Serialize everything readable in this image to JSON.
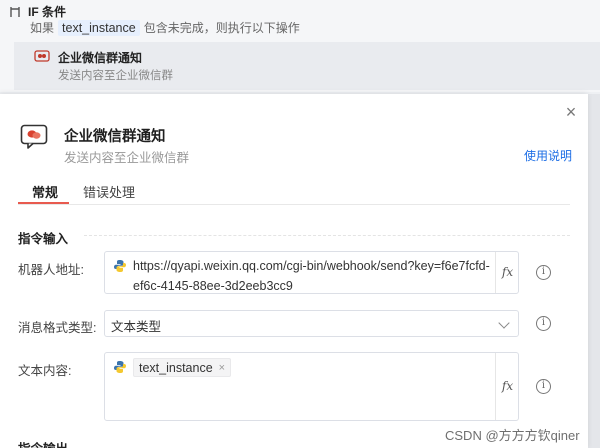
{
  "workflow": {
    "if_title": "IF 条件",
    "if_desc_prefix": "如果",
    "if_variable": "text_instance",
    "if_desc_suffix": "包含未完成，则执行以下操作",
    "step": {
      "title": "企业微信群通知",
      "subtitle": "发送内容至企业微信群"
    }
  },
  "panel": {
    "close_icon": "×",
    "title": "企业微信群通知",
    "subtitle": "发送内容至企业微信群",
    "help_link": "使用说明",
    "tabs": [
      {
        "label": "常规",
        "active": true
      },
      {
        "label": "错误处理",
        "active": false
      }
    ],
    "section_title": "指令输入",
    "fields": {
      "robot_url": {
        "label": "机器人地址:",
        "value": "https://qyapi.weixin.qq.com/cgi-bin/webhook/send?key=f6e7fcfd-ef6c-4145-88ee-3d2eeb3cc9",
        "fx": "fx",
        "info": "i"
      },
      "msg_format": {
        "label": "消息格式类型:",
        "value": "文本类型",
        "info": "i"
      },
      "text_content": {
        "label": "文本内容:",
        "tag": "text_instance",
        "tag_close": "×",
        "fx": "fx",
        "info": "i"
      }
    },
    "next_section_partial": "指令输出"
  },
  "watermark": "CSDN @方方方钦qiner",
  "colors": {
    "accent": "#e85a4f",
    "link": "#1d6ee5",
    "python_blue": "#3b74ad",
    "python_yellow": "#f4c82f"
  }
}
